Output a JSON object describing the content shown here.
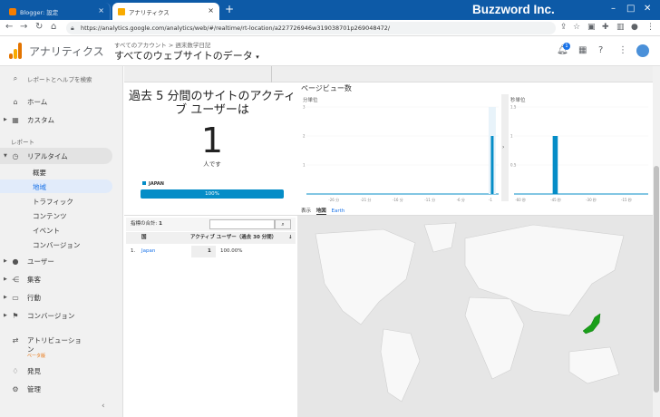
{
  "browser": {
    "tabs": [
      {
        "title": "Blogger: 設定",
        "active": false
      },
      {
        "title": "アナリティクス",
        "active": true
      }
    ],
    "url": "https://analytics.google.com/analytics/web/#/realtime/rt-location/a227726946w319038701p269048472/",
    "watermark": "Buzzword Inc."
  },
  "header": {
    "app_title": "アナリティクス",
    "breadcrumb": "すべてのアカウント > 週末数学日記",
    "property": "すべてのウェブサイトのデータ",
    "notification_count": "1"
  },
  "sidebar": {
    "search": "レポートとヘルプを検索",
    "home": "ホーム",
    "custom": "カスタム",
    "section_reports": "レポート",
    "realtime": "リアルタイム",
    "realtime_items": [
      "概要",
      "地域",
      "トラフィック",
      "コンテンツ",
      "イベント",
      "コンバージョン"
    ],
    "user": "ユーザー",
    "acquisition": "集客",
    "behavior": "行動",
    "conversion": "コンバージョン",
    "attribution": "アトリビューショ",
    "attribution_tail": "ン",
    "beta": "ベータ版",
    "discover": "発見",
    "admin": "管理"
  },
  "active_users": {
    "title": "過去 5 分間のサイトのアクティブ ユーザーは",
    "count": "1",
    "unit": "人です",
    "country": "JAPAN",
    "progress_label": "100%",
    "progress_fraction": 1.0
  },
  "pageviews": {
    "title": "ページビュー数",
    "per_minute_label": "分単位",
    "per_second_label": "秒単位",
    "views": {
      "display": "表示",
      "map": "地図",
      "earth": "Earth"
    }
  },
  "table": {
    "total_label": "指標の合計:",
    "total_value": "1",
    "col_country": "国",
    "col_active": "アクティブ ユーザー（過去 30 分間）",
    "sort_arrow": "↓",
    "rows": [
      {
        "index": "1.",
        "country": "Japan",
        "users": "1",
        "percent": "100.00%"
      }
    ]
  },
  "chart_data": [
    {
      "type": "bar",
      "title": "分単位",
      "x_ticks": [
        "-26 分",
        "-21 分",
        "-16 分",
        "-11 分",
        "-6 分",
        "-1"
      ],
      "y_ticks": [
        "3",
        "2",
        "1"
      ],
      "ylim": [
        0,
        3
      ],
      "x": [
        -1
      ],
      "values": [
        2
      ]
    },
    {
      "type": "bar",
      "title": "秒単位",
      "x_ticks": [
        "-60 秒",
        "-45 秒",
        "-30 秒",
        "-15 秒"
      ],
      "y_ticks": [
        "1.5",
        "1",
        "0.5"
      ],
      "ylim": [
        0,
        1.5
      ],
      "x": [
        -45,
        -44
      ],
      "values": [
        1,
        1
      ]
    }
  ],
  "colors": {
    "accent": "#058dc7",
    "highlight": "#1a9f1a",
    "tabbar": "#0d5aa7"
  }
}
